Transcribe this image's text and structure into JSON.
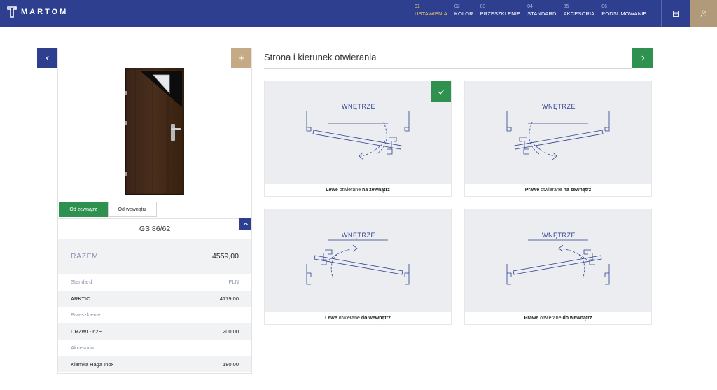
{
  "brand": {
    "name": "MARTOM"
  },
  "steps": [
    {
      "num": "01",
      "label": "USTAWIENIA",
      "active": true
    },
    {
      "num": "02",
      "label": "KOLOR"
    },
    {
      "num": "03",
      "label": "PRZESZKLENIE"
    },
    {
      "num": "04",
      "label": "STANDARD"
    },
    {
      "num": "05",
      "label": "AKCESORIA"
    },
    {
      "num": "06",
      "label": "PODSUMOWANIE"
    }
  ],
  "header_icons": {
    "list": "list-icon",
    "user": "user-icon"
  },
  "colors": {
    "primary": "#2e3f8f",
    "accent": "#2e9150",
    "gold": "#c4ab86",
    "active_step": "#e9c46a"
  },
  "left": {
    "view_tabs": [
      "Od zewnątrz",
      "Od wewnątrz"
    ],
    "model": "GS 86/62",
    "total_label": "RAZEM",
    "total_value": "4559,00",
    "rows": [
      {
        "type": "cat",
        "label": "Standard",
        "value": "PLN"
      },
      {
        "type": "item",
        "label": "ARKTIC",
        "value": "4179,00"
      },
      {
        "type": "cat",
        "label": "Przeszklenie",
        "value": ""
      },
      {
        "type": "item",
        "label": "DRZWI - 62E",
        "value": "200,00"
      },
      {
        "type": "cat",
        "label": "Akcesoria",
        "value": ""
      },
      {
        "type": "item",
        "label": "Klamka Haga Inox",
        "value": "180,00"
      }
    ]
  },
  "main": {
    "title": "Strona i kierunek otwierania",
    "diagram_label": "WNĘTRZE",
    "options": [
      {
        "side": "Lewe",
        "mid": "otwierane",
        "dir": "na zewnątrz",
        "selected": true
      },
      {
        "side": "Prawe",
        "mid": "otwierane",
        "dir": "na zewnątrz",
        "selected": false
      },
      {
        "side": "Lewe",
        "mid": "otwierane",
        "dir": "do wewnątrz",
        "selected": false
      },
      {
        "side": "Prawe",
        "mid": "otwierane",
        "dir": "do wewnątrz",
        "selected": false
      }
    ]
  }
}
